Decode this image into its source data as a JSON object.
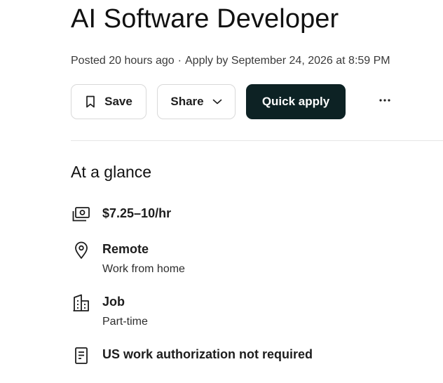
{
  "job": {
    "title": "AI Software Developer",
    "posted": "Posted 20 hours ago",
    "separator": "·",
    "apply_by": "Apply by September 24, 2026 at 8:59 PM"
  },
  "actions": {
    "save_label": "Save",
    "share_label": "Share",
    "quick_apply_label": "Quick apply",
    "more_label": "···"
  },
  "glance": {
    "heading": "At a glance",
    "items": [
      {
        "icon": "money-icon",
        "main": "$7.25–10/hr"
      },
      {
        "icon": "location-pin-icon",
        "main": "Remote",
        "sub": "Work from home"
      },
      {
        "icon": "building-icon",
        "main": "Job",
        "sub": "Part-time"
      },
      {
        "icon": "document-icon",
        "main": "US work authorization not required"
      }
    ]
  },
  "colors": {
    "primary_button": "#0d2224",
    "text": "#1d1d1d",
    "border": "#d9d9d9"
  }
}
